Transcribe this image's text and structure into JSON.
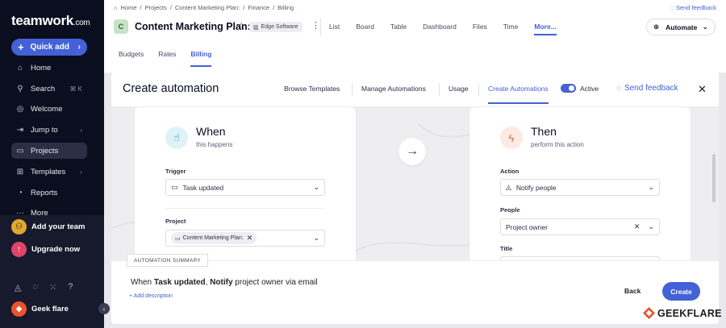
{
  "sidebar": {
    "logo_main": "teamwork",
    "logo_suffix": ".com",
    "quick_add": "Quick add",
    "items": [
      {
        "label": "Home",
        "icon": "home-icon"
      },
      {
        "label": "Search",
        "icon": "search-icon",
        "shortcut": "⌘ K"
      },
      {
        "label": "Welcome",
        "icon": "compass-icon"
      },
      {
        "label": "Jump to",
        "icon": "jump-icon"
      },
      {
        "label": "Projects",
        "icon": "folder-icon"
      },
      {
        "label": "Templates",
        "icon": "templates-icon"
      },
      {
        "label": "Reports",
        "icon": "reports-icon"
      },
      {
        "label": "More",
        "icon": "more-icon"
      }
    ],
    "add_team": "Add your team",
    "upgrade": "Upgrade now",
    "user_name": "Geek flare"
  },
  "header": {
    "breadcrumbs": [
      "Home",
      "Projects",
      "Content Marketing Plan:",
      "Finance",
      "Billing"
    ],
    "send_feedback": "Send feedback",
    "project_initial": "C",
    "project_title": "Content Marketing Plan:",
    "company_tag": "Edge Software",
    "views": [
      "List",
      "Board",
      "Table",
      "Dashboard",
      "Files",
      "Time",
      "More..."
    ],
    "automate": "Automate",
    "subtabs": [
      "Budgets",
      "Rates",
      "Billing"
    ]
  },
  "modal": {
    "title": "Create automation",
    "tabs": [
      "Browse Templates",
      "Manage Automations",
      "Usage",
      "Create Automations"
    ],
    "active_label": "Active",
    "send_feedback": "Send feedback",
    "when": {
      "title": "When",
      "subtitle": "this happens",
      "trigger_label": "Trigger",
      "trigger_value": "Task updated",
      "project_label": "Project",
      "project_value": "Content Marketing Plan:"
    },
    "then": {
      "title": "Then",
      "subtitle": "perform this action",
      "action_label": "Action",
      "action_value": "Notify people",
      "people_label": "People",
      "people_value": "Project owner",
      "title_label": "Title"
    },
    "summary": {
      "tag": "AUTOMATION SUMMARY",
      "text_prefix": "When ",
      "text_bold1": "Task updated",
      "text_mid": ", ",
      "text_bold2": "Notify",
      "text_suffix": " project owner via email",
      "add_description": "+ Add description"
    },
    "back": "Back",
    "create": "Create"
  },
  "watermark": "GEEKFLARE",
  "colors": {
    "accent": "#4461d7",
    "sidebar_bg": "#0b0e1f",
    "when_icon_bg": "#dff3f6",
    "then_icon_bg": "#fdeae2",
    "then_icon": "#e96a3b"
  }
}
